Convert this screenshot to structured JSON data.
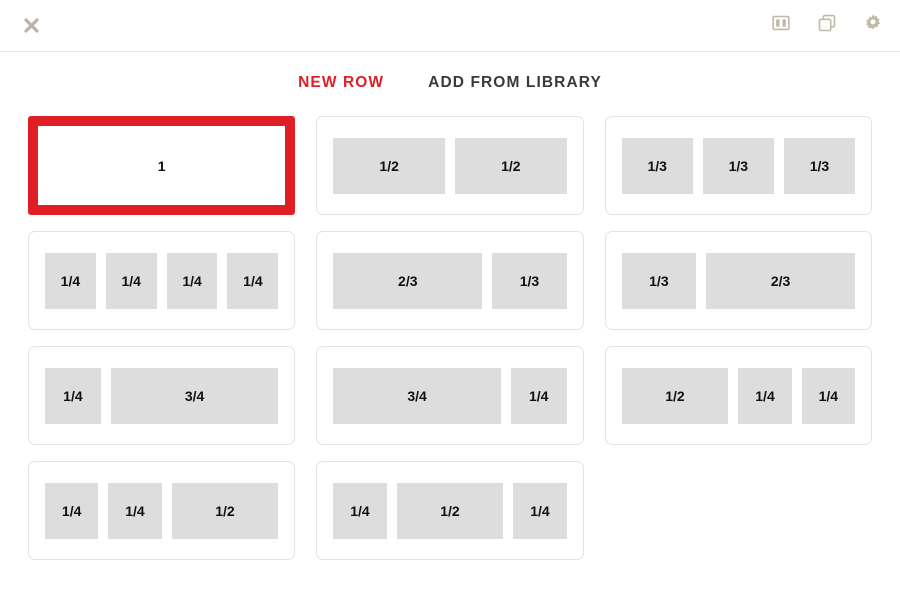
{
  "topbar": {
    "close_icon": "close-icon",
    "actions": [
      {
        "name": "columns-layout-icon",
        "label": "Columns layout"
      },
      {
        "name": "duplicate-icon",
        "label": "Duplicate"
      },
      {
        "name": "gear-icon",
        "label": "Settings"
      }
    ]
  },
  "tabs": [
    {
      "label": "NEW ROW",
      "active": true
    },
    {
      "label": "ADD FROM LIBRARY",
      "active": false
    }
  ],
  "colors": {
    "accent": "#e01e26",
    "cell_fill": "#dddddd",
    "card_border": "#e3e3e3",
    "icon": "#c3b9a9",
    "tab_inactive": "#3a3a3a"
  },
  "layouts": [
    {
      "id": "layout-1",
      "selected": true,
      "cells": [
        {
          "label": "1",
          "fr": 1
        }
      ]
    },
    {
      "id": "layout-1-2-1-2",
      "selected": false,
      "cells": [
        {
          "label": "1/2",
          "fr": 1
        },
        {
          "label": "1/2",
          "fr": 1
        }
      ]
    },
    {
      "id": "layout-1-3-1-3-1-3",
      "selected": false,
      "cells": [
        {
          "label": "1/3",
          "fr": 1
        },
        {
          "label": "1/3",
          "fr": 1
        },
        {
          "label": "1/3",
          "fr": 1
        }
      ]
    },
    {
      "id": "layout-1-4-x4",
      "selected": false,
      "cells": [
        {
          "label": "1/4",
          "fr": 1
        },
        {
          "label": "1/4",
          "fr": 1
        },
        {
          "label": "1/4",
          "fr": 1
        },
        {
          "label": "1/4",
          "fr": 1
        }
      ]
    },
    {
      "id": "layout-2-3-1-3",
      "selected": false,
      "cells": [
        {
          "label": "2/3",
          "fr": 2
        },
        {
          "label": "1/3",
          "fr": 1
        }
      ]
    },
    {
      "id": "layout-1-3-2-3",
      "selected": false,
      "cells": [
        {
          "label": "1/3",
          "fr": 1
        },
        {
          "label": "2/3",
          "fr": 2
        }
      ]
    },
    {
      "id": "layout-1-4-3-4",
      "selected": false,
      "cells": [
        {
          "label": "1/4",
          "fr": 1
        },
        {
          "label": "3/4",
          "fr": 3
        }
      ]
    },
    {
      "id": "layout-3-4-1-4",
      "selected": false,
      "cells": [
        {
          "label": "3/4",
          "fr": 3
        },
        {
          "label": "1/4",
          "fr": 1
        }
      ]
    },
    {
      "id": "layout-1-2-1-4-1-4",
      "selected": false,
      "cells": [
        {
          "label": "1/2",
          "fr": 2
        },
        {
          "label": "1/4",
          "fr": 1
        },
        {
          "label": "1/4",
          "fr": 1
        }
      ]
    },
    {
      "id": "layout-1-4-1-4-1-2",
      "selected": false,
      "cells": [
        {
          "label": "1/4",
          "fr": 1
        },
        {
          "label": "1/4",
          "fr": 1
        },
        {
          "label": "1/2",
          "fr": 2
        }
      ]
    },
    {
      "id": "layout-1-4-1-2-1-4",
      "selected": false,
      "cells": [
        {
          "label": "1/4",
          "fr": 1
        },
        {
          "label": "1/2",
          "fr": 2
        },
        {
          "label": "1/4",
          "fr": 1
        }
      ]
    }
  ]
}
